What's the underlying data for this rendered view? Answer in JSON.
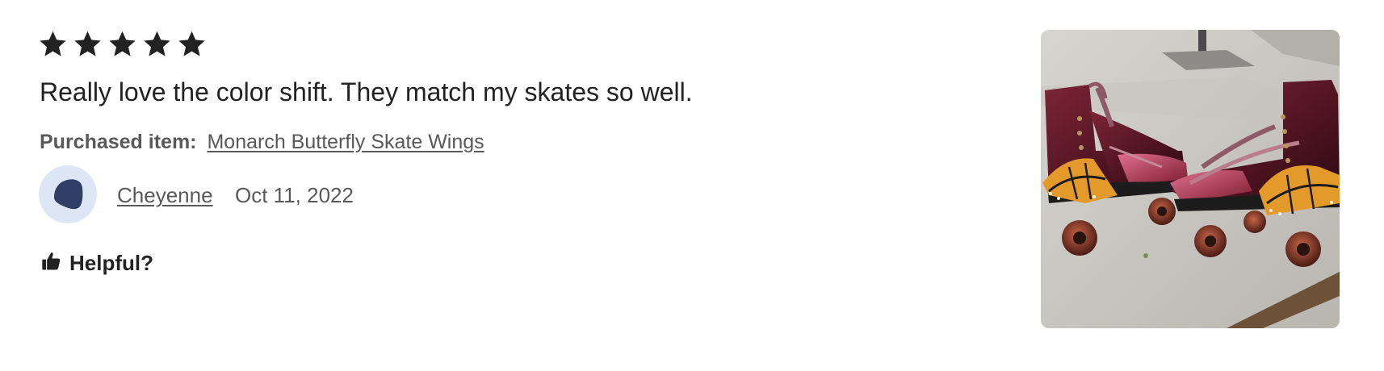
{
  "review": {
    "rating": 5,
    "rating_max": 5,
    "text": "Really love the color shift. They match my skates so well.",
    "purchased_label": "Purchased item:",
    "purchased_item": "Monarch Butterfly Skate Wings",
    "reviewer": "Cheyenne",
    "date": "Oct 11, 2022",
    "helpful_label": "Helpful?",
    "photo_subject": "roller skates with monarch butterfly wings",
    "icons": [
      "star-icon",
      "thumbs-up-icon"
    ]
  },
  "colors": {
    "text_primary": "#222222",
    "text_secondary": "#595959",
    "avatar_bg": "#dde6f4",
    "avatar_fg": "#2f3f66"
  }
}
